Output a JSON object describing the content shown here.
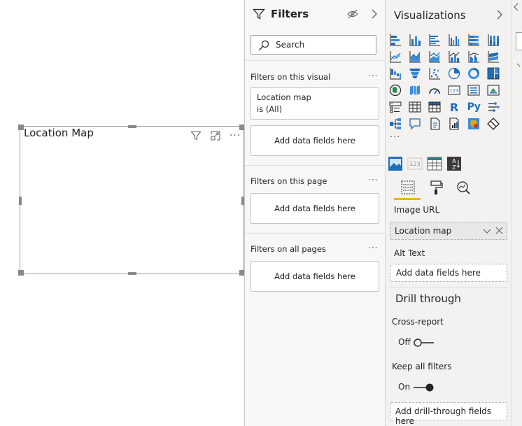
{
  "visual": {
    "title": "Location Map",
    "header_icons": [
      "filter-icon",
      "focus-mode-icon",
      "more-options-icon"
    ],
    "more": "···"
  },
  "filters": {
    "title": "Filters",
    "search_placeholder": "Search",
    "more": "···",
    "on_visual": {
      "label": "Filters on this visual",
      "card_line1": "Location map",
      "card_line2": "is (All)",
      "add": "Add data fields here"
    },
    "on_page": {
      "label": "Filters on this page",
      "add": "Add data fields here"
    },
    "on_all_pages": {
      "label": "Filters on all pages",
      "add": "Add data fields here"
    }
  },
  "visualizations": {
    "title": "Visualizations",
    "more": "···",
    "r_label": "R",
    "py_label": "Py",
    "icons": [
      "stacked-bar-chart-icon",
      "stacked-column-chart-icon",
      "clustered-bar-chart-icon",
      "clustered-column-chart-icon",
      "100-stacked-bar-chart-icon",
      "100-stacked-column-chart-icon",
      "line-chart-icon",
      "area-chart-icon",
      "stacked-area-chart-icon",
      "line-and-stacked-column-icon",
      "line-and-clustered-column-icon",
      "ribbon-chart-icon",
      "waterfall-chart-icon",
      "funnel-icon",
      "scatter-chart-icon",
      "pie-chart-icon",
      "donut-chart-icon",
      "treemap-icon",
      "map-icon",
      "filled-map-icon",
      "gauge-icon",
      "card-icon",
      "multi-row-card-icon",
      "kpi-icon",
      "slicer-icon",
      "table-icon",
      "matrix-icon",
      "r-script-visual-icon",
      "python-visual-icon",
      "key-influencers-icon",
      "decomposition-tree-icon",
      "qna-icon",
      "paginated-report-icon",
      "smart-narrative-icon",
      "arcgis-map-icon",
      "power-apps-icon"
    ],
    "custom_icons": [
      "image-visual-icon",
      "number-card-icon",
      "table-visual-icon",
      "sort-az-icon"
    ],
    "tab_icons": [
      "fields-tab-icon",
      "format-tab-icon",
      "analytics-tab-icon"
    ],
    "image_url_label": "Image URL",
    "image_url_value": "Location map",
    "alt_text_label": "Alt Text",
    "alt_text_add": "Add data fields here",
    "drill_title": "Drill through",
    "cross_report_label": "Cross-report",
    "cross_report_state": "Off",
    "keep_filters_label": "Keep all filters",
    "keep_filters_state": "On",
    "drill_add": "Add drill-through fields here"
  },
  "colors": {
    "accent_yellow": "#e8b700",
    "icon_blue": "#1f6ebb",
    "icon_teal": "#3a8dde",
    "pane_bg": "#f3f2f1",
    "filters_bg": "#f7f7f7"
  }
}
